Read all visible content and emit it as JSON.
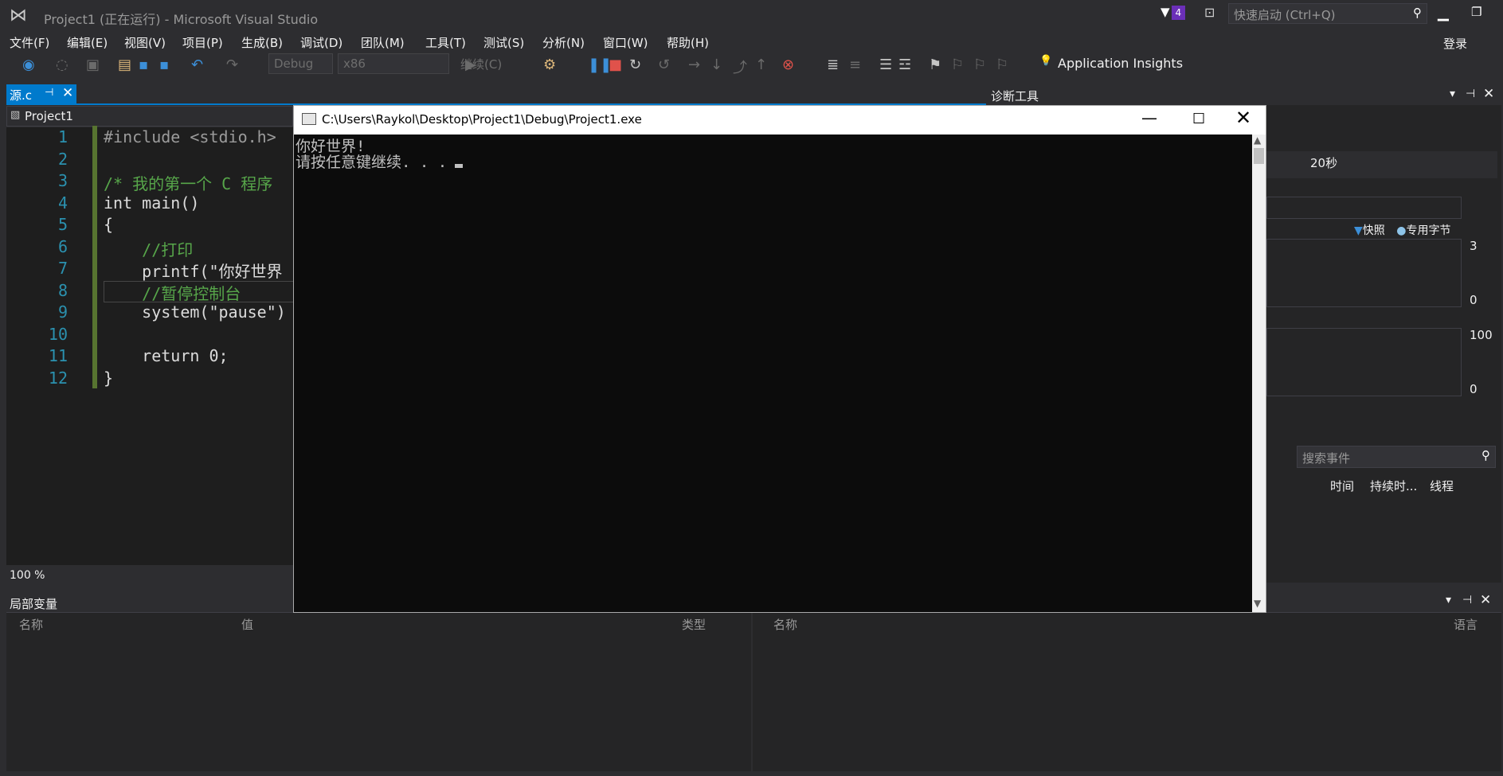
{
  "window": {
    "title": "Project1 (正在运行) - Microsoft Visual Studio",
    "notification_count": "4",
    "quick_launch_placeholder": "快速启动 (Ctrl+Q)",
    "login": "登录"
  },
  "menu": [
    "文件(F)",
    "编辑(E)",
    "视图(V)",
    "项目(P)",
    "生成(B)",
    "调试(D)",
    "团队(M)",
    "工具(T)",
    "测试(S)",
    "分析(N)",
    "窗口(W)",
    "帮助(H)"
  ],
  "toolbar": {
    "config": "Debug",
    "platform": "x86",
    "continue_label": "继续(C)",
    "app_insights": "Application Insights"
  },
  "editor": {
    "tab_label": "源.c",
    "nav_label": "Project1",
    "zoom": "100 %",
    "lines": [
      {
        "n": "1",
        "text": "#include <stdio.h>"
      },
      {
        "n": "2",
        "text": ""
      },
      {
        "n": "3",
        "text": "/* 我的第一个 C 程序"
      },
      {
        "n": "4",
        "text": "int main()"
      },
      {
        "n": "5",
        "text": "{"
      },
      {
        "n": "6",
        "text": "    //打印"
      },
      {
        "n": "7",
        "text": "    printf(\"你好世界"
      },
      {
        "n": "8",
        "text": "    //暂停控制台"
      },
      {
        "n": "9",
        "text": "    system(\"pause\")"
      },
      {
        "n": "10",
        "text": ""
      },
      {
        "n": "11",
        "text": "    return 0;"
      },
      {
        "n": "12",
        "text": "}"
      }
    ]
  },
  "diagnostics": {
    "title": "诊断工具",
    "ruler_label": "20秒",
    "legend_snapshot": "快照",
    "legend_bytes": "专用字节",
    "axis_top_1": "3",
    "axis_bottom_1": "0",
    "axis_top_2": "100",
    "axis_bottom_2": "0",
    "search_placeholder": "搜索事件",
    "columns": [
      "时间",
      "持续时...",
      "线程"
    ]
  },
  "locals": {
    "title": "局部变量",
    "columns": [
      "名称",
      "值",
      "类型"
    ]
  },
  "bottom_right": {
    "columns": [
      "名称",
      "语言"
    ]
  },
  "console": {
    "title": "C:\\Users\\Raykol\\Desktop\\Project1\\Debug\\Project1.exe",
    "lines": [
      "你好世界!",
      "请按任意键继续. . ."
    ]
  }
}
